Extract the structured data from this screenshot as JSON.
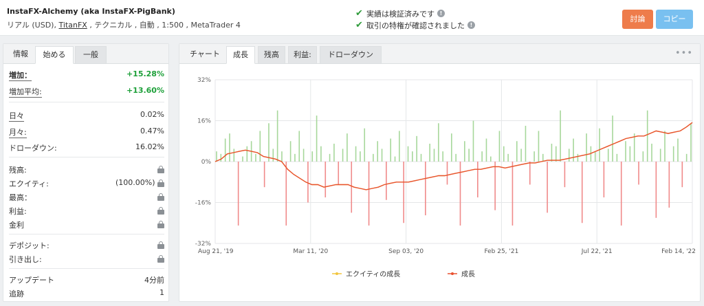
{
  "header": {
    "title": "InstaFX-Alchemy (aka InstaFX-PigBank)",
    "sub_prefix": "リアル (USD),",
    "broker": "TitanFX",
    "sub_suffix": ", テクニカル , 自動 , 1:500 , MetaTrader 4",
    "check1": "実績は検証済みです",
    "check2": "取引の特権が確認されました",
    "discuss_label": "討論",
    "copy_label": "コピー"
  },
  "left_tabs": [
    "情報",
    "始める",
    "一般"
  ],
  "stats": {
    "gain_label": "増加：",
    "gain_value": "+15.28%",
    "avg_gain_label": "増加平均:",
    "avg_gain_value": "+13.60%",
    "daily_label": "日々",
    "daily_value": "0.02%",
    "monthly_label": "月々:",
    "monthly_value": "0.47%",
    "drawdown_label": "ドローダウン:",
    "drawdown_value": "16.02%",
    "balance_label": "残高:",
    "equity_label": "エクイティ:",
    "equity_value": "(100.00%)",
    "highest_label": "最高：",
    "profit_label": "利益:",
    "interest_label": "金利",
    "deposits_label": "デポジット:",
    "withdrawals_label": "引き出し:",
    "updated_label": "アップデート",
    "updated_value": "4分前",
    "tracking_label": "追跡",
    "tracking_value": "1",
    "lock_icon": "lock-icon"
  },
  "right_tabs": [
    "チャート",
    "成長",
    "残高",
    "利益:",
    "ドローダウン"
  ],
  "menu_icon": "more-dots-icon",
  "chart_data": {
    "type": "bar+line",
    "ylim": [
      -32,
      32
    ],
    "yticks": [
      "32%",
      "16%",
      "0%",
      "-16%",
      "-32%"
    ],
    "xticks": [
      "Aug 21, '19",
      "Mar 11, '20",
      "Sep 03, '20",
      "Feb 25, '21",
      "Jul 22, '21",
      "Feb 14, '22"
    ],
    "legend": [
      "エクイティの成長",
      "成長"
    ],
    "colors": {
      "growth": "#e8502f",
      "equity": "#f2c53d",
      "pos_bar": "#a6d79a",
      "neg_bar": "#f08a8a",
      "grid": "#e4e6e8"
    },
    "growth_line": [
      0,
      1,
      3,
      3.5,
      4,
      4.5,
      4,
      3.5,
      2,
      1.5,
      1,
      0,
      -3,
      -5,
      -6.5,
      -8,
      -9,
      -9,
      -10,
      -9.5,
      -9,
      -9,
      -9,
      -10,
      -10.5,
      -11,
      -10.5,
      -10,
      -9,
      -8.5,
      -8,
      -8,
      -8,
      -7.5,
      -7,
      -6.5,
      -6,
      -5.5,
      -5.5,
      -5,
      -4.5,
      -4,
      -3.5,
      -3,
      -3,
      -2.5,
      -2,
      -2,
      -2.5,
      -2,
      -1.5,
      -1,
      -0.5,
      -0.5,
      0,
      0.5,
      0.5,
      0.5,
      1,
      1.5,
      2,
      2.5,
      3,
      4,
      5,
      6,
      7,
      8,
      9,
      9.5,
      10,
      10,
      11,
      12,
      11.5,
      11,
      11.5,
      12,
      13.5,
      15.28
    ],
    "bars": [
      4,
      3,
      9,
      11,
      5,
      -25,
      2,
      6,
      8,
      3,
      12,
      -10,
      15,
      5,
      20,
      4,
      -25,
      8,
      3,
      12,
      5,
      -16,
      4,
      18,
      6,
      -14,
      3,
      7,
      -9,
      5,
      11,
      -20,
      6,
      4,
      13,
      -25,
      3,
      8,
      5,
      -15,
      9,
      2,
      12,
      -24,
      6,
      4,
      10,
      3,
      -21,
      7,
      5,
      15,
      4,
      -9,
      11,
      3,
      -25,
      8,
      5,
      16,
      -14,
      4,
      9,
      2,
      -19,
      12,
      6,
      3,
      -25,
      8,
      5,
      14,
      -9,
      4,
      12,
      3,
      -20,
      7,
      6,
      20,
      -10,
      5,
      9,
      3,
      -24,
      11,
      6,
      4,
      13,
      -14,
      5,
      18,
      3,
      -25,
      8,
      6,
      11,
      -9,
      4,
      20,
      7,
      -22,
      5,
      12,
      -18,
      6,
      9,
      -10,
      3,
      15
    ]
  }
}
